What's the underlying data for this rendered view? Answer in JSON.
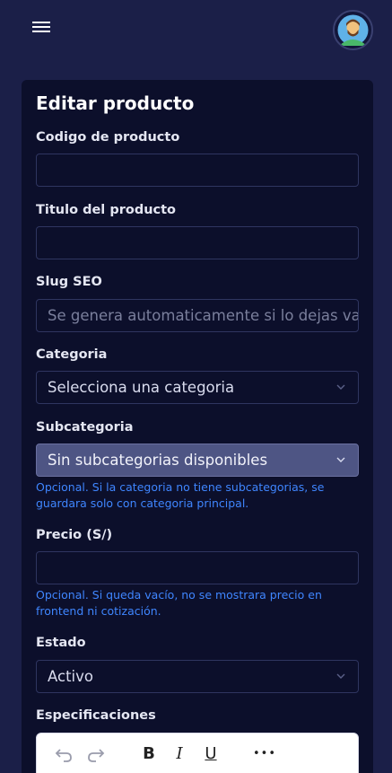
{
  "header": {
    "menu_icon": "hamburger-menu-icon",
    "avatar_icon": "user-avatar"
  },
  "form": {
    "title": "Editar producto",
    "code_label": "Codigo de producto",
    "code_value": "",
    "title_label": "Titulo del producto",
    "title_value": "",
    "slug_label": "Slug SEO",
    "slug_placeholder": "Se genera automaticamente si lo dejas vacío",
    "category_label": "Categoria",
    "category_value": "Selecciona una categoria",
    "subcategory_label": "Subcategoria",
    "subcategory_value": "Sin subcategorias disponibles",
    "subcategory_help": "Opcional. Si la categoria no tiene subcategorias, se guardara solo con categoria principal.",
    "price_label": "Precio (S/)",
    "price_value": "",
    "price_help": "Opcional. Si queda vacío, no se mostrara precio en frontend ni cotización.",
    "status_label": "Estado",
    "status_value": "Activo",
    "specs_label": "Especificaciones"
  },
  "editor_toolbar": {
    "undo_icon": "undo-icon",
    "redo_icon": "redo-icon",
    "bold": "B",
    "italic": "I",
    "underline": "U",
    "more": "•••"
  }
}
